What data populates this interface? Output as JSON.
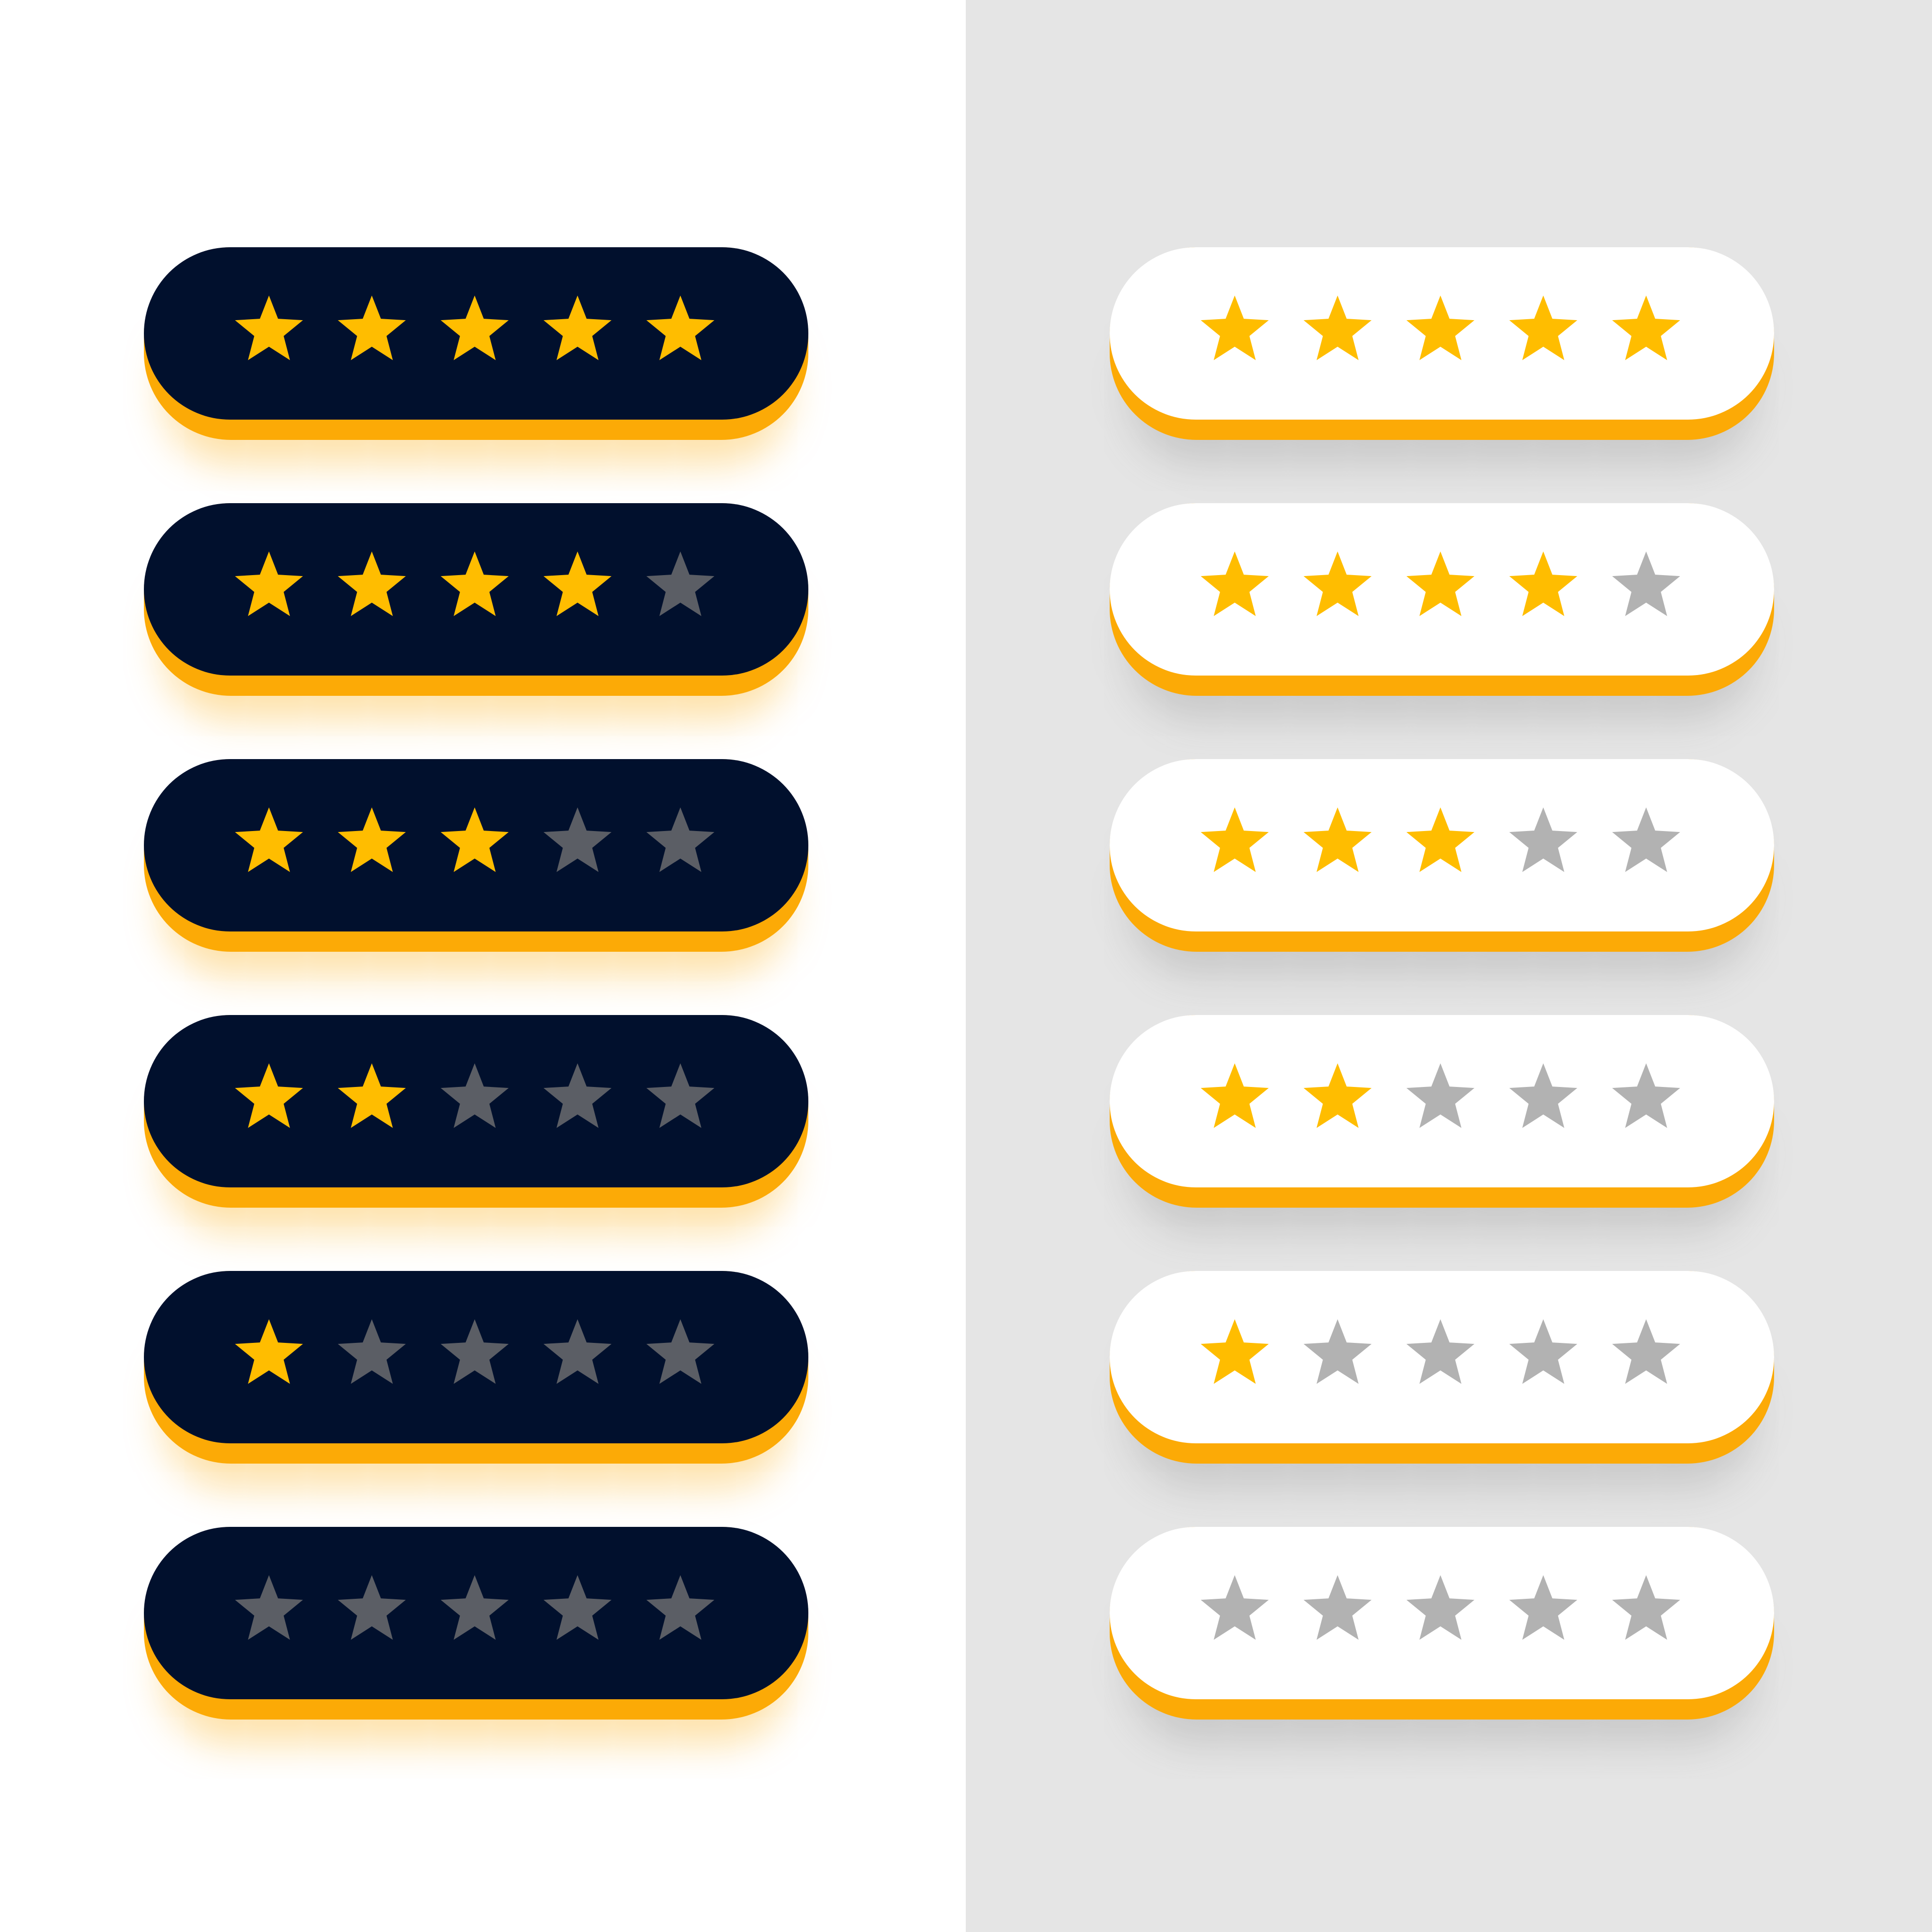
{
  "colors": {
    "left_background": "#ffffff",
    "right_background": "#e5e5e5",
    "dark_bar": "#01102d",
    "light_bar": "#ffffff",
    "bar_underside": "#fcaa06",
    "star_filled": "#ffbd00",
    "star_empty_dark": "#5b5e65",
    "star_empty_light": "#b2b2b2"
  },
  "max_stars": 5,
  "dark_panel": {
    "ratings": [
      5,
      4,
      3,
      2,
      1,
      0
    ]
  },
  "light_panel": {
    "ratings": [
      5,
      4,
      3,
      2,
      1,
      0
    ]
  }
}
